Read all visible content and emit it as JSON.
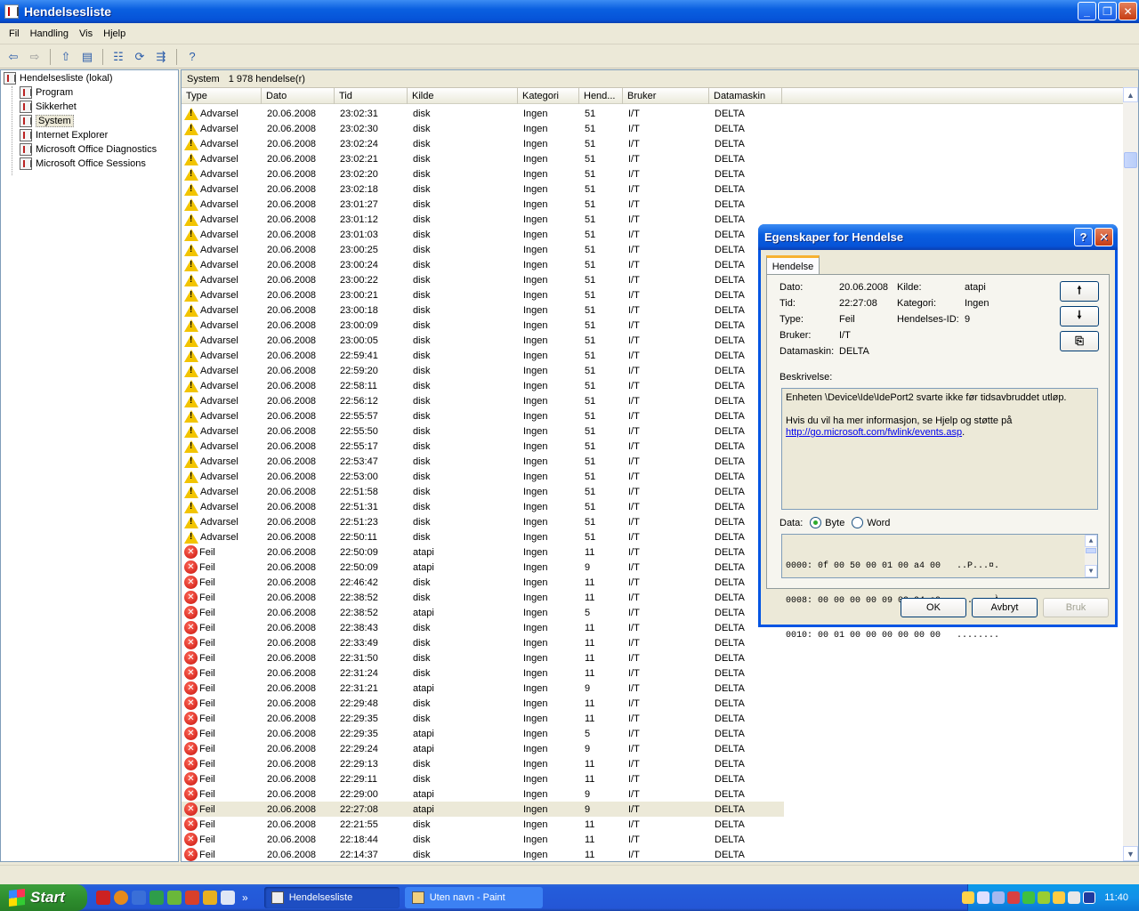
{
  "window": {
    "title": "Hendelsesliste",
    "min": "_",
    "max": "❐",
    "close": "✕"
  },
  "menu": [
    "Fil",
    "Handling",
    "Vis",
    "Hjelp"
  ],
  "toolbar_icons": [
    "back-icon",
    "forward-icon",
    "up-folder-icon",
    "show-tree-icon",
    "properties-icon",
    "refresh-icon",
    "export-icon",
    "help-icon"
  ],
  "tree": {
    "root": "Hendelsesliste (lokal)",
    "items": [
      "Program",
      "Sikkerhet",
      "System",
      "Internet Explorer",
      "Microsoft Office Diagnostics",
      "Microsoft Office Sessions"
    ],
    "selected": "System"
  },
  "list": {
    "header_name": "System",
    "header_count": "1 978 hendelse(r)",
    "columns": [
      "Type",
      "Dato",
      "Tid",
      "Kilde",
      "Kategori",
      "Hend...",
      "Bruker",
      "Datamaskin"
    ],
    "rows": [
      [
        "warn",
        "Advarsel",
        "20.06.2008",
        "23:02:31",
        "disk",
        "Ingen",
        "51",
        "I/T",
        "DELTA"
      ],
      [
        "warn",
        "Advarsel",
        "20.06.2008",
        "23:02:30",
        "disk",
        "Ingen",
        "51",
        "I/T",
        "DELTA"
      ],
      [
        "warn",
        "Advarsel",
        "20.06.2008",
        "23:02:24",
        "disk",
        "Ingen",
        "51",
        "I/T",
        "DELTA"
      ],
      [
        "warn",
        "Advarsel",
        "20.06.2008",
        "23:02:21",
        "disk",
        "Ingen",
        "51",
        "I/T",
        "DELTA"
      ],
      [
        "warn",
        "Advarsel",
        "20.06.2008",
        "23:02:20",
        "disk",
        "Ingen",
        "51",
        "I/T",
        "DELTA"
      ],
      [
        "warn",
        "Advarsel",
        "20.06.2008",
        "23:02:18",
        "disk",
        "Ingen",
        "51",
        "I/T",
        "DELTA"
      ],
      [
        "warn",
        "Advarsel",
        "20.06.2008",
        "23:01:27",
        "disk",
        "Ingen",
        "51",
        "I/T",
        "DELTA"
      ],
      [
        "warn",
        "Advarsel",
        "20.06.2008",
        "23:01:12",
        "disk",
        "Ingen",
        "51",
        "I/T",
        "DELTA"
      ],
      [
        "warn",
        "Advarsel",
        "20.06.2008",
        "23:01:03",
        "disk",
        "Ingen",
        "51",
        "I/T",
        "DELTA"
      ],
      [
        "warn",
        "Advarsel",
        "20.06.2008",
        "23:00:25",
        "disk",
        "Ingen",
        "51",
        "I/T",
        "DELTA"
      ],
      [
        "warn",
        "Advarsel",
        "20.06.2008",
        "23:00:24",
        "disk",
        "Ingen",
        "51",
        "I/T",
        "DELTA"
      ],
      [
        "warn",
        "Advarsel",
        "20.06.2008",
        "23:00:22",
        "disk",
        "Ingen",
        "51",
        "I/T",
        "DELTA"
      ],
      [
        "warn",
        "Advarsel",
        "20.06.2008",
        "23:00:21",
        "disk",
        "Ingen",
        "51",
        "I/T",
        "DELTA"
      ],
      [
        "warn",
        "Advarsel",
        "20.06.2008",
        "23:00:18",
        "disk",
        "Ingen",
        "51",
        "I/T",
        "DELTA"
      ],
      [
        "warn",
        "Advarsel",
        "20.06.2008",
        "23:00:09",
        "disk",
        "Ingen",
        "51",
        "I/T",
        "DELTA"
      ],
      [
        "warn",
        "Advarsel",
        "20.06.2008",
        "23:00:05",
        "disk",
        "Ingen",
        "51",
        "I/T",
        "DELTA"
      ],
      [
        "warn",
        "Advarsel",
        "20.06.2008",
        "22:59:41",
        "disk",
        "Ingen",
        "51",
        "I/T",
        "DELTA"
      ],
      [
        "warn",
        "Advarsel",
        "20.06.2008",
        "22:59:20",
        "disk",
        "Ingen",
        "51",
        "I/T",
        "DELTA"
      ],
      [
        "warn",
        "Advarsel",
        "20.06.2008",
        "22:58:11",
        "disk",
        "Ingen",
        "51",
        "I/T",
        "DELTA"
      ],
      [
        "warn",
        "Advarsel",
        "20.06.2008",
        "22:56:12",
        "disk",
        "Ingen",
        "51",
        "I/T",
        "DELTA"
      ],
      [
        "warn",
        "Advarsel",
        "20.06.2008",
        "22:55:57",
        "disk",
        "Ingen",
        "51",
        "I/T",
        "DELTA"
      ],
      [
        "warn",
        "Advarsel",
        "20.06.2008",
        "22:55:50",
        "disk",
        "Ingen",
        "51",
        "I/T",
        "DELTA"
      ],
      [
        "warn",
        "Advarsel",
        "20.06.2008",
        "22:55:17",
        "disk",
        "Ingen",
        "51",
        "I/T",
        "DELTA"
      ],
      [
        "warn",
        "Advarsel",
        "20.06.2008",
        "22:53:47",
        "disk",
        "Ingen",
        "51",
        "I/T",
        "DELTA"
      ],
      [
        "warn",
        "Advarsel",
        "20.06.2008",
        "22:53:00",
        "disk",
        "Ingen",
        "51",
        "I/T",
        "DELTA"
      ],
      [
        "warn",
        "Advarsel",
        "20.06.2008",
        "22:51:58",
        "disk",
        "Ingen",
        "51",
        "I/T",
        "DELTA"
      ],
      [
        "warn",
        "Advarsel",
        "20.06.2008",
        "22:51:31",
        "disk",
        "Ingen",
        "51",
        "I/T",
        "DELTA"
      ],
      [
        "warn",
        "Advarsel",
        "20.06.2008",
        "22:51:23",
        "disk",
        "Ingen",
        "51",
        "I/T",
        "DELTA"
      ],
      [
        "warn",
        "Advarsel",
        "20.06.2008",
        "22:50:11",
        "disk",
        "Ingen",
        "51",
        "I/T",
        "DELTA"
      ],
      [
        "err",
        "Feil",
        "20.06.2008",
        "22:50:09",
        "atapi",
        "Ingen",
        "11",
        "I/T",
        "DELTA"
      ],
      [
        "err",
        "Feil",
        "20.06.2008",
        "22:50:09",
        "atapi",
        "Ingen",
        "9",
        "I/T",
        "DELTA"
      ],
      [
        "err",
        "Feil",
        "20.06.2008",
        "22:46:42",
        "disk",
        "Ingen",
        "11",
        "I/T",
        "DELTA"
      ],
      [
        "err",
        "Feil",
        "20.06.2008",
        "22:38:52",
        "disk",
        "Ingen",
        "11",
        "I/T",
        "DELTA"
      ],
      [
        "err",
        "Feil",
        "20.06.2008",
        "22:38:52",
        "atapi",
        "Ingen",
        "5",
        "I/T",
        "DELTA"
      ],
      [
        "err",
        "Feil",
        "20.06.2008",
        "22:38:43",
        "disk",
        "Ingen",
        "11",
        "I/T",
        "DELTA"
      ],
      [
        "err",
        "Feil",
        "20.06.2008",
        "22:33:49",
        "disk",
        "Ingen",
        "11",
        "I/T",
        "DELTA"
      ],
      [
        "err",
        "Feil",
        "20.06.2008",
        "22:31:50",
        "disk",
        "Ingen",
        "11",
        "I/T",
        "DELTA"
      ],
      [
        "err",
        "Feil",
        "20.06.2008",
        "22:31:24",
        "disk",
        "Ingen",
        "11",
        "I/T",
        "DELTA"
      ],
      [
        "err",
        "Feil",
        "20.06.2008",
        "22:31:21",
        "atapi",
        "Ingen",
        "9",
        "I/T",
        "DELTA"
      ],
      [
        "err",
        "Feil",
        "20.06.2008",
        "22:29:48",
        "disk",
        "Ingen",
        "11",
        "I/T",
        "DELTA"
      ],
      [
        "err",
        "Feil",
        "20.06.2008",
        "22:29:35",
        "disk",
        "Ingen",
        "11",
        "I/T",
        "DELTA"
      ],
      [
        "err",
        "Feil",
        "20.06.2008",
        "22:29:35",
        "atapi",
        "Ingen",
        "5",
        "I/T",
        "DELTA"
      ],
      [
        "err",
        "Feil",
        "20.06.2008",
        "22:29:24",
        "atapi",
        "Ingen",
        "9",
        "I/T",
        "DELTA"
      ],
      [
        "err",
        "Feil",
        "20.06.2008",
        "22:29:13",
        "disk",
        "Ingen",
        "11",
        "I/T",
        "DELTA"
      ],
      [
        "err",
        "Feil",
        "20.06.2008",
        "22:29:11",
        "disk",
        "Ingen",
        "11",
        "I/T",
        "DELTA"
      ],
      [
        "err",
        "Feil",
        "20.06.2008",
        "22:29:00",
        "atapi",
        "Ingen",
        "9",
        "I/T",
        "DELTA"
      ],
      [
        "err",
        "Feil",
        "20.06.2008",
        "22:27:08",
        "atapi",
        "Ingen",
        "9",
        "I/T",
        "DELTA"
      ],
      [
        "err",
        "Feil",
        "20.06.2008",
        "22:21:55",
        "disk",
        "Ingen",
        "11",
        "I/T",
        "DELTA"
      ],
      [
        "err",
        "Feil",
        "20.06.2008",
        "22:18:44",
        "disk",
        "Ingen",
        "11",
        "I/T",
        "DELTA"
      ],
      [
        "err",
        "Feil",
        "20.06.2008",
        "22:14:37",
        "disk",
        "Ingen",
        "11",
        "I/T",
        "DELTA"
      ]
    ],
    "highlighted_row": 46
  },
  "dialog": {
    "title": "Egenskaper for Hendelse",
    "help": "?",
    "close": "✕",
    "tab": "Hendelse",
    "fields": {
      "date_label": "Dato:",
      "date": "20.06.2008",
      "time_label": "Tid:",
      "time": "22:27:08",
      "type_label": "Type:",
      "type": "Feil",
      "user_label": "Bruker:",
      "user": "I/T",
      "computer_label": "Datamaskin:",
      "computer": "DELTA",
      "source_label": "Kilde:",
      "source": "atapi",
      "category_label": "Kategori:",
      "category": "Ingen",
      "eventid_label": "Hendelses-ID:",
      "eventid": "9"
    },
    "nav": {
      "up": "🠕",
      "down": "🠗",
      "copy": "⎘"
    },
    "description_label": "Beskrivelse:",
    "description_line1": "Enheten \\Device\\Ide\\IdePort2 svarte ikke før tidsavbruddet utløp.",
    "description_line2": "Hvis du vil ha mer informasjon, se Hjelp og støtte på",
    "description_link": "http://go.microsoft.com/fwlink/events.asp",
    "description_end": ".",
    "data_label": "Data:",
    "radio_byte": "Byte",
    "radio_word": "Word",
    "hex_lines": [
      "0000: 0f 00 50 00 01 00 a4 00   ..P...¤.",
      "0008: 00 00 00 00 09 00 04 c0   .......À",
      "0010: 00 01 00 00 00 00 00 00   ........"
    ],
    "ok": "OK",
    "cancel": "Avbryt",
    "apply": "Bruk"
  },
  "taskbar": {
    "start": "Start",
    "arrows": "»",
    "items": [
      "Hendelsesliste",
      "Uten navn - Paint"
    ],
    "clock": "11:40"
  }
}
